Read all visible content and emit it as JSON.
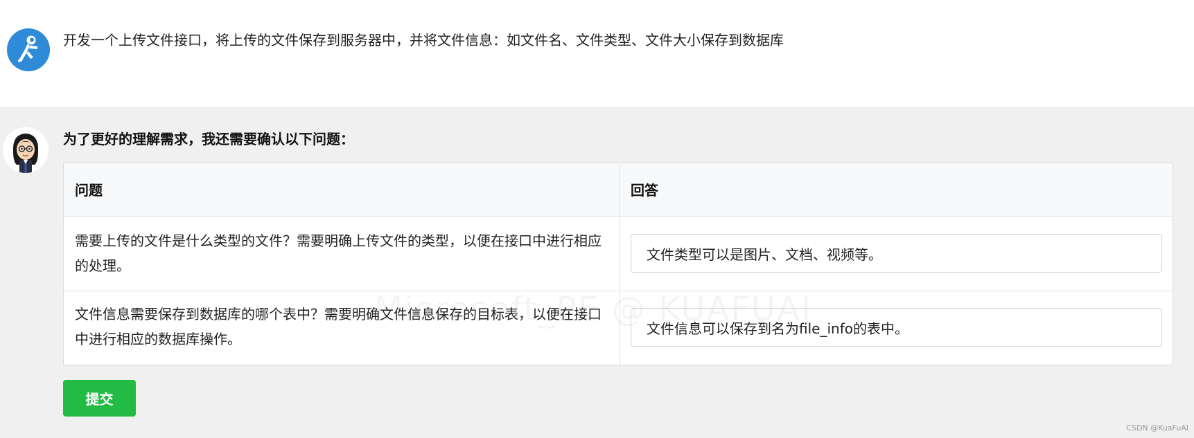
{
  "user": {
    "avatar_icon": "astronaut-icon",
    "message": "开发一个上传文件接口，将上传的文件保存到服务器中，并将文件信息：如文件名、文件类型、文件大小保存到数据库"
  },
  "bot": {
    "avatar_icon": "cartoon-woman-avatar",
    "prompt": "为了更好的理解需求，我还需要确认以下问题：",
    "table": {
      "headers": [
        "问题",
        "回答"
      ],
      "rows": [
        {
          "question": "需要上传的文件是什么类型的文件？需要明确上传文件的类型，以便在接口中进行相应的处理。",
          "answer": "文件类型可以是图片、文档、视频等。"
        },
        {
          "question": "文件信息需要保存到数据库的哪个表中？需要明确文件信息保存的目标表，以便在接口中进行相应的数据库操作。",
          "answer": "文件信息可以保存到名为file_info的表中。"
        }
      ]
    },
    "submit_label": "提交"
  },
  "watermark": "Microsoft_PE @ KUAFUAI",
  "footer": "CSDN @KuaFuAI",
  "colors": {
    "page_bg": "#ffffff",
    "bot_bg": "#f0f0f0",
    "submit_bg": "#22bb44",
    "avatar_blue": "#2f8ad8"
  }
}
